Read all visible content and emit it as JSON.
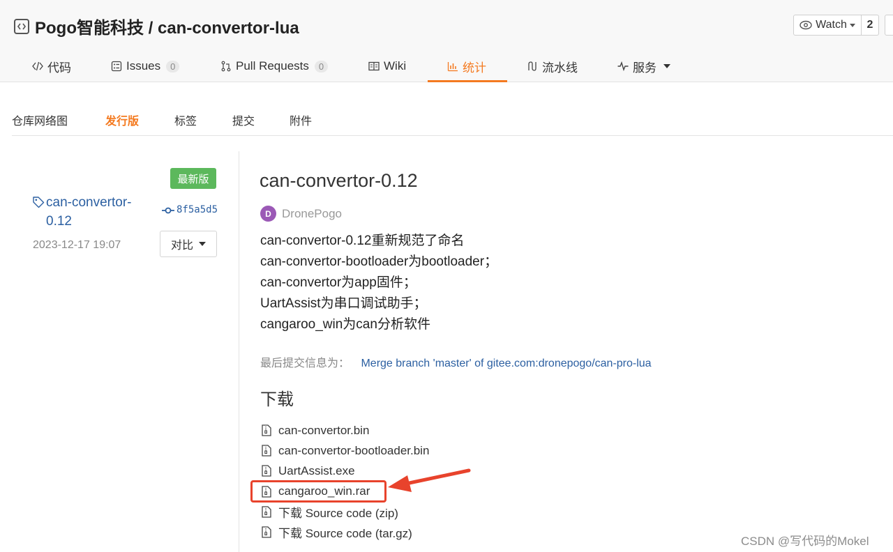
{
  "header": {
    "repo_title": "Pogo智能科技 / can-convertor-lua",
    "watch_label": "Watch",
    "watch_count": "2"
  },
  "tabs": [
    {
      "label": "代码",
      "icon": "code-icon"
    },
    {
      "label": "Issues",
      "count": "0",
      "icon": "issues-icon"
    },
    {
      "label": "Pull Requests",
      "count": "0",
      "icon": "pull-request-icon"
    },
    {
      "label": "Wiki",
      "icon": "wiki-icon"
    },
    {
      "label": "统计",
      "icon": "stats-icon",
      "active": true
    },
    {
      "label": "流水线",
      "icon": "pipeline-icon"
    },
    {
      "label": "服务",
      "icon": "service-icon"
    }
  ],
  "subnav": [
    {
      "label": "仓库网络图"
    },
    {
      "label": "发行版",
      "active": true
    },
    {
      "label": "标签"
    },
    {
      "label": "提交"
    },
    {
      "label": "附件"
    }
  ],
  "release": {
    "badge": "最新版",
    "tag_name": "can-convertor-0.12",
    "commit_hash": "8f5a5d5",
    "date": "2023-12-17 19:07",
    "compare_label": "对比",
    "title": "can-convertor-0.12",
    "author_initial": "D",
    "author": "DronePogo",
    "notes": [
      "can-convertor-0.12重新规范了命名",
      "can-convertor-bootloader为bootloader；",
      "can-convertor为app固件；",
      "UartAssist为串口调试助手；",
      "cangaroo_win为can分析软件"
    ],
    "commit_info_label": "最后提交信息为：",
    "commit_info_link": "Merge branch 'master' of gitee.com:dronepogo/can-pro-lua",
    "downloads_heading": "下载",
    "downloads": [
      "can-convertor.bin",
      "can-convertor-bootloader.bin",
      "UartAssist.exe",
      "cangaroo_win.rar",
      "下载 Source code (zip)",
      "下载 Source code (tar.gz)"
    ]
  },
  "colors": {
    "accent": "#f47a20",
    "link": "#2b5fa1",
    "badge": "#5cb85c",
    "annotation": "#e8432c"
  },
  "watermark": "CSDN @写代码的Mokel"
}
